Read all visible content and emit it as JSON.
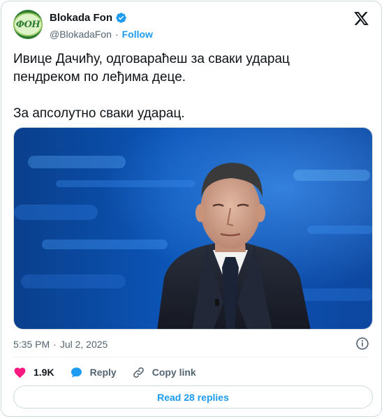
{
  "author": {
    "name": "Blokada Fon",
    "handle": "@BlokadaFon",
    "follow_label": "Follow",
    "avatar_text": "ФОН"
  },
  "tweet": {
    "text": "Ивице Дачићу, одговараћеш за сваки ударац\nпендреком по леђима деце.\n\nЗа апсолутно сваки ударац.",
    "time": "5:35 PM",
    "date": "Jul 2, 2025"
  },
  "actions": {
    "likes": "1.9K",
    "reply_label": "Reply",
    "copy_label": "Copy link"
  },
  "read_replies_label": "Read 28 replies",
  "colors": {
    "accent": "#1d9bf0",
    "like": "#f91880",
    "text": "#0f1419",
    "muted": "#536471"
  },
  "icons": [
    "verified-badge-icon",
    "x-logo-icon",
    "info-icon",
    "heart-icon",
    "reply-bubble-icon",
    "link-icon"
  ]
}
